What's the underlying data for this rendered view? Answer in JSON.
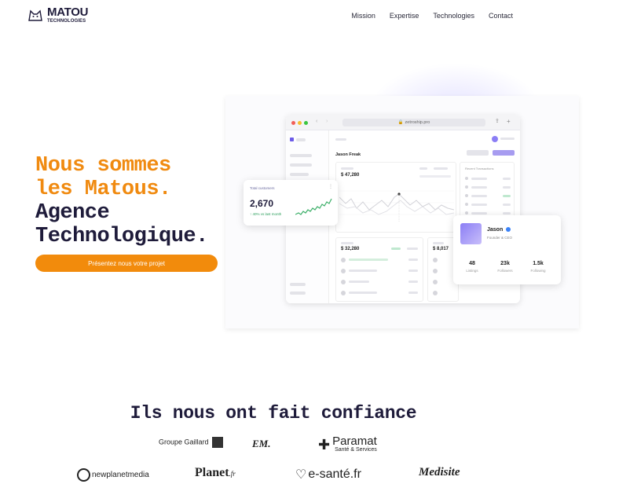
{
  "header": {
    "logo_title": "MATOU",
    "logo_subtitle": "TECHNOLOGIES",
    "nav": [
      "Mission",
      "Expertise",
      "Technologies",
      "Contact"
    ]
  },
  "hero": {
    "line1": "Nous sommes",
    "line2": "les Matous.",
    "line3": "Agence",
    "line4": "Technologique.",
    "cta": "Présentez nous votre projet",
    "accent_color": "#f28b0c",
    "dark_color": "#1e1b3a"
  },
  "mockup": {
    "url": "zetroship.pro",
    "profile_title": "Jason Freak",
    "balance_1": "$ 47,280",
    "balance_2": "$ 32,280",
    "balance_3": "$ 8,017",
    "recent_transactions": "Recent Transactions",
    "customers_card": {
      "label": "Total customers",
      "value": "2,670",
      "delta": "40% vs last month"
    },
    "profile_card": {
      "name": "Jason",
      "role": "Founder & CEO",
      "stats": [
        {
          "value": "48",
          "label": "Listings"
        },
        {
          "value": "23k",
          "label": "Followers"
        },
        {
          "value": "1.5k",
          "label": "Following"
        }
      ]
    }
  },
  "trust": {
    "title": "Ils nous ont fait confiance",
    "partners": {
      "groupe_gaillard": "Groupe Gaillard",
      "em": "EM.",
      "paramat": "Paramat",
      "paramat_sub": "Santé & Services",
      "newplanet": "newplanetmedia",
      "planet": "Planet",
      "planet_tld": ".fr",
      "esante": "e-santé.fr",
      "medisite": "Medisite"
    }
  }
}
